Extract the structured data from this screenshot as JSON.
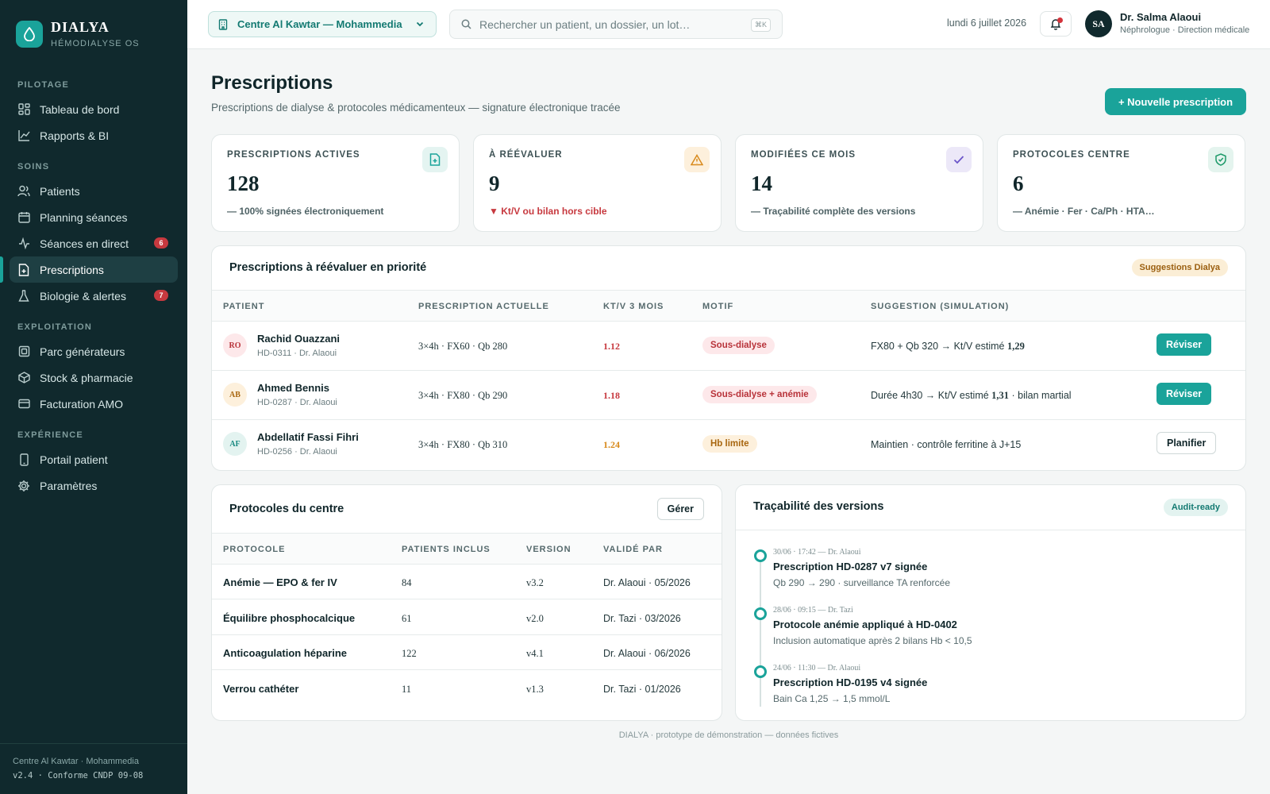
{
  "brand": {
    "name": "DIALYA",
    "subtitle": "HÉMODIALYSE OS"
  },
  "sidebar": {
    "sections": [
      {
        "title": "PILOTAGE",
        "items": [
          {
            "label": "Tableau de bord",
            "icon": "dashboard-icon"
          },
          {
            "label": "Rapports & BI",
            "icon": "chart-icon"
          }
        ]
      },
      {
        "title": "SOINS",
        "items": [
          {
            "label": "Patients",
            "icon": "users-icon"
          },
          {
            "label": "Planning séances",
            "icon": "calendar-icon"
          },
          {
            "label": "Séances en direct",
            "icon": "activity-icon",
            "badge": "6"
          },
          {
            "label": "Prescriptions",
            "icon": "file-plus-icon",
            "active": true
          },
          {
            "label": "Biologie & alertes",
            "icon": "flask-icon",
            "badge": "7"
          }
        ]
      },
      {
        "title": "EXPLOITATION",
        "items": [
          {
            "label": "Parc générateurs",
            "icon": "machine-icon"
          },
          {
            "label": "Stock & pharmacie",
            "icon": "box-icon"
          },
          {
            "label": "Facturation AMO",
            "icon": "card-icon"
          }
        ]
      },
      {
        "title": "EXPÉRIENCE",
        "items": [
          {
            "label": "Portail patient",
            "icon": "phone-icon"
          },
          {
            "label": "Paramètres",
            "icon": "gear-icon"
          }
        ]
      }
    ],
    "footer": {
      "center": "Centre Al Kawtar · Mohammedia",
      "version": "v2.4 · Conforme CNDP 09-08"
    }
  },
  "header": {
    "center_select": "Centre Al Kawtar — Mohammedia",
    "search_placeholder": "Rechercher un patient, un dossier, un lot…",
    "search_shortcut": "⌘K",
    "date": "lundi 6 juillet 2026",
    "user": {
      "initials": "SA",
      "name": "Dr. Salma Alaoui",
      "role": "Néphrologue · Direction médicale"
    }
  },
  "page": {
    "title": "Prescriptions",
    "subtitle": "Prescriptions de dialyse & protocoles médicamenteux — signature électronique tracée",
    "new_button": "+ Nouvelle prescription"
  },
  "kpis": [
    {
      "label": "PRESCRIPTIONS ACTIVES",
      "value": "128",
      "note": "— 100% signées électroniquement",
      "icon": "file-plus-icon",
      "alert": false
    },
    {
      "label": "À RÉÉVALUER",
      "value": "9",
      "note": "▼ Kt/V ou bilan hors cible",
      "icon": "warning-icon",
      "alert": true
    },
    {
      "label": "MODIFIÉES CE MOIS",
      "value": "14",
      "note": "— Traçabilité complète des versions",
      "icon": "check-icon",
      "alert": false
    },
    {
      "label": "PROTOCOLES CENTRE",
      "value": "6",
      "note": "— Anémie · Fer · Ca/Ph · HTA…",
      "icon": "shield-check-icon",
      "alert": false
    }
  ],
  "review": {
    "title": "Prescriptions à réévaluer en priorité",
    "badge": "Suggestions Dialya",
    "columns": [
      "PATIENT",
      "PRESCRIPTION ACTUELLE",
      "KT/V 3 MOIS",
      "MOTIF",
      "SUGGESTION (SIMULATION)"
    ],
    "rows": [
      {
        "initials": "RO",
        "name": "Rachid Ouazzani",
        "meta": "HD-0311 · Dr. Alaoui",
        "prescription": "3×4h · FX60 · Qb 280",
        "ktv": "1.12",
        "motif": "Sous-dialyse",
        "suggestion": "FX80 + Qb 320 → Kt/V estimé",
        "suggestion_value": "1,29",
        "suggestion_tail": "",
        "action": "Réviser"
      },
      {
        "initials": "AB",
        "name": "Ahmed Bennis",
        "meta": "HD-0287 · Dr. Alaoui",
        "prescription": "3×4h · FX80 · Qb 290",
        "ktv": "1.18",
        "motif": "Sous-dialyse + anémie",
        "suggestion": "Durée 4h30 → Kt/V estimé",
        "suggestion_value": "1,31",
        "suggestion_tail": "· bilan martial",
        "action": "Réviser"
      },
      {
        "initials": "AF",
        "name": "Abdellatif Fassi Fihri",
        "meta": "HD-0256 · Dr. Alaoui",
        "prescription": "3×4h · FX80 · Qb 310",
        "ktv": "1.24",
        "motif": "Hb limite",
        "suggestion": "Maintien · contrôle ferritine à J+15",
        "suggestion_value": "",
        "suggestion_tail": "",
        "action": "Planifier"
      }
    ]
  },
  "protocols": {
    "title": "Protocoles du centre",
    "manage_button": "Gérer",
    "columns": [
      "PROTOCOLE",
      "PATIENTS INCLUS",
      "VERSION",
      "VALIDÉ PAR"
    ],
    "rows": [
      {
        "name": "Anémie — EPO & fer IV",
        "patients": "84",
        "version": "v3.2",
        "validated": "Dr. Alaoui · 05/2026"
      },
      {
        "name": "Équilibre phosphocalcique",
        "patients": "61",
        "version": "v2.0",
        "validated": "Dr. Tazi · 03/2026"
      },
      {
        "name": "Anticoagulation héparine",
        "patients": "122",
        "version": "v4.1",
        "validated": "Dr. Alaoui · 06/2026"
      },
      {
        "name": "Verrou cathéter",
        "patients": "11",
        "version": "v1.3",
        "validated": "Dr. Tazi · 01/2026"
      }
    ]
  },
  "versions": {
    "title": "Traçabilité des versions",
    "badge": "Audit-ready",
    "events": [
      {
        "meta": "30/06 · 17:42 — Dr. Alaoui",
        "title": "Prescription HD-0287 v7 signée",
        "desc": "Qb 290 → 290 · surveillance TA renforcée"
      },
      {
        "meta": "28/06 · 09:15 — Dr. Tazi",
        "title": "Protocole anémie appliqué à HD-0402",
        "desc": "Inclusion automatique après 2 bilans Hb < 10,5"
      },
      {
        "meta": "24/06 · 11:30 — Dr. Alaoui",
        "title": "Prescription HD-0195 v4 signée",
        "desc": "Bain Ca 1,25 → 1,5 mmol/L"
      }
    ]
  },
  "footer_note": "DIALYA · prototype de démonstration — données fictives",
  "colors": {
    "accent": "#1aa39a",
    "sidebar": "#10292d",
    "danger": "#c7393f",
    "warning": "#d88a1c"
  }
}
